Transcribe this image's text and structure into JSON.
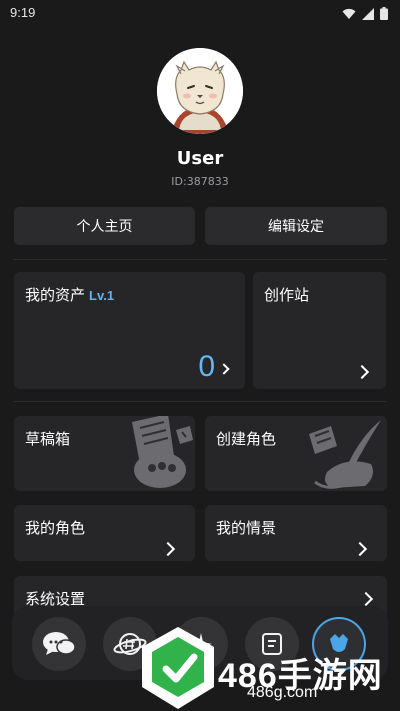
{
  "status": {
    "time": "9:19"
  },
  "profile": {
    "name": "User",
    "id": "ID:387833"
  },
  "actions": {
    "home": "个人主页",
    "settings": "编辑设定"
  },
  "assets": {
    "title": "我的资产",
    "level": "Lv.1",
    "count": "0"
  },
  "studio": {
    "title": "创作站"
  },
  "drafts": {
    "title": "草稿箱"
  },
  "create_character": {
    "title": "创建角色"
  },
  "my_characters": {
    "title": "我的角色"
  },
  "my_scenes": {
    "title": "我的情景"
  },
  "system_settings": {
    "title": "系统设置"
  },
  "nav": {
    "icons": [
      "chat-bubbles-icon",
      "planet-hashtag-icon",
      "sparkle-icon",
      "card-icon",
      "profile-icon"
    ]
  },
  "watermark": {
    "text": "486手游网",
    "url": "486g.com"
  }
}
